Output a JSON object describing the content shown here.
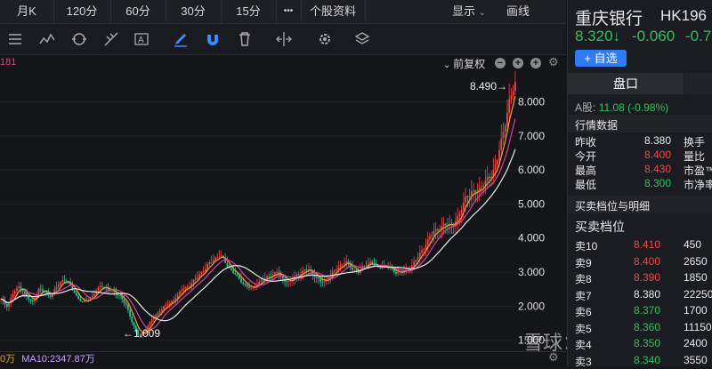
{
  "toolbar": {
    "tabs": [
      "月K",
      "120分",
      "60分",
      "30分",
      "15分"
    ],
    "more": "•••",
    "stock_info": "个股资料",
    "display": "显示",
    "draw": "画线"
  },
  "chart": {
    "fq_label": "前复权",
    "left_code": "181",
    "high_label": "8.490→",
    "low_label": "←1.009",
    "y_ticks": [
      "8.000",
      "7.000",
      "6.000",
      "5.000",
      "4.000",
      "3.000",
      "2.000",
      "1.000"
    ],
    "bottom_vol": "0万",
    "ma10": "MA10:2347.87万",
    "watermark": "雪球：鹏哥投研"
  },
  "stock": {
    "name": "重庆银行",
    "code": "HK196",
    "price": "8.320↓",
    "change": "-0.060",
    "pct": "-0.7",
    "watch_btn": "+ 自选",
    "tab_pankou": "盘口",
    "a_share_label": "A股:",
    "a_share_value": "11.08 (-0.98%)",
    "section_market": "行情数据",
    "market": [
      {
        "label": "昨收",
        "value": "8.380",
        "color": "white",
        "r": "换手"
      },
      {
        "label": "今开",
        "value": "8.400",
        "color": "red",
        "r": "量比"
      },
      {
        "label": "最高",
        "value": "8.430",
        "color": "red",
        "r": "市盈™"
      },
      {
        "label": "最低",
        "value": "8.300",
        "color": "green",
        "r": "市净率"
      }
    ],
    "section_orders": "买卖档位与明细",
    "orders_title": "买卖档位",
    "orders": [
      {
        "label": "卖10",
        "price": "8.410",
        "vol": "450",
        "color": "red"
      },
      {
        "label": "卖9",
        "price": "8.400",
        "vol": "2650",
        "color": "red"
      },
      {
        "label": "卖8",
        "price": "8.390",
        "vol": "1850",
        "color": "red"
      },
      {
        "label": "卖7",
        "price": "8.380",
        "vol": "22250",
        "color": "white"
      },
      {
        "label": "卖6",
        "price": "8.370",
        "vol": "1700",
        "color": "green"
      },
      {
        "label": "卖5",
        "price": "8.360",
        "vol": "11150",
        "color": "green"
      },
      {
        "label": "卖4",
        "price": "8.350",
        "vol": "2400",
        "color": "green"
      },
      {
        "label": "卖3",
        "price": "8.340",
        "vol": "3550",
        "color": "green"
      }
    ]
  },
  "chart_data": {
    "type": "line",
    "title": "",
    "ylim": [
      1.0,
      8.5
    ],
    "y_ticks": [
      1,
      2,
      3,
      4,
      5,
      6,
      7,
      8
    ],
    "high": 8.49,
    "low": 1.009,
    "series": [
      {
        "values": [
          2.2,
          2.0,
          2.4,
          2.6,
          2.3,
          2.1,
          2.5,
          2.4,
          2.3,
          2.6,
          2.8,
          2.6,
          2.3,
          2.1,
          2.2,
          2.4,
          2.6,
          2.5,
          2.4,
          2.3,
          2.0,
          1.5,
          1.1,
          1.3,
          1.6,
          1.8,
          2.0,
          2.1,
          2.3,
          2.5,
          2.6,
          2.8,
          3.0,
          3.2,
          3.4,
          3.5,
          3.2,
          3.0,
          2.8,
          2.6,
          2.5,
          2.7,
          2.8,
          2.9,
          3.0,
          2.8,
          2.7,
          2.9,
          3.0,
          3.1,
          2.9,
          2.7,
          2.8,
          3.0,
          3.2,
          3.3,
          3.1,
          3.0,
          3.2,
          3.3,
          3.1,
          3.2,
          3.1,
          3.0,
          3.0,
          3.1,
          3.3,
          3.6,
          3.9,
          4.2,
          4.3,
          4.4,
          4.4,
          4.6,
          5.2,
          5.3,
          5.4,
          5.6,
          5.8,
          6.2,
          7.0,
          8.0,
          8.49
        ]
      }
    ]
  }
}
